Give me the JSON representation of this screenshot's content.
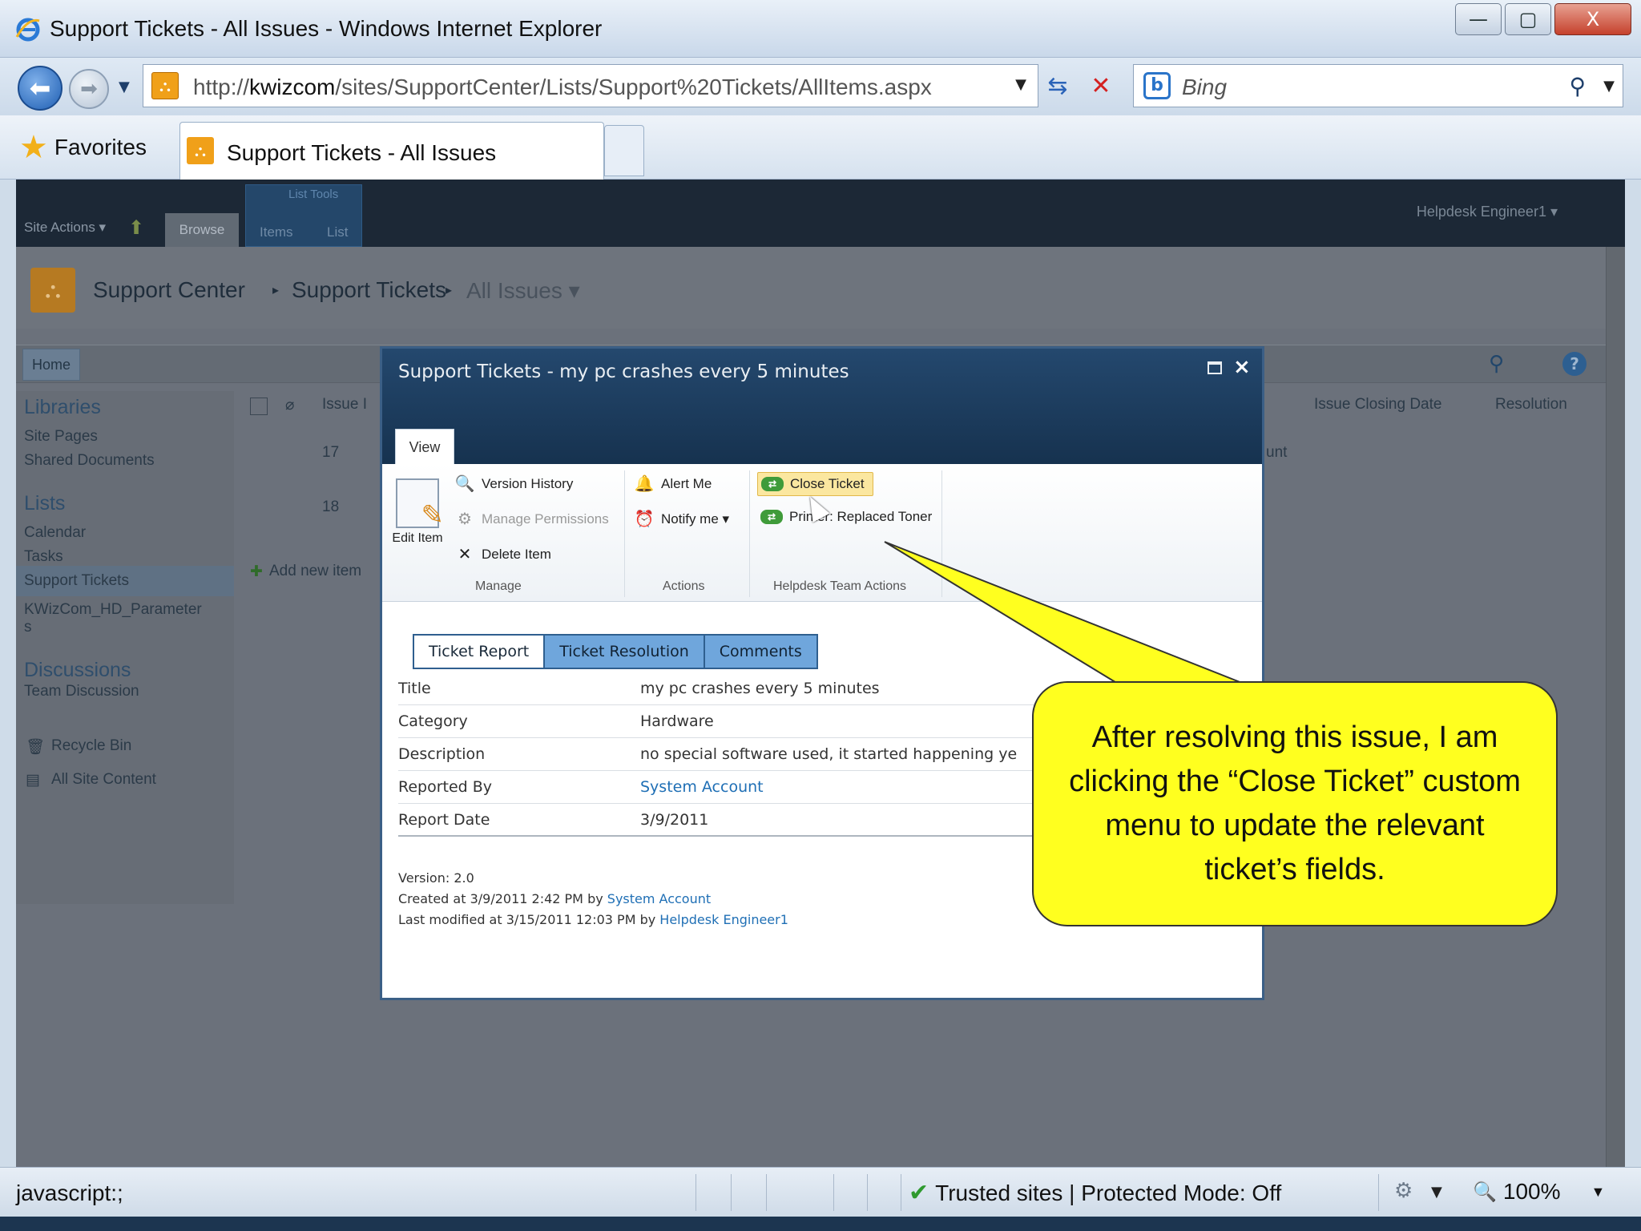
{
  "window": {
    "title": "Support Tickets - All Issues - Windows Internet Explorer",
    "controls": {
      "minimize": "—",
      "maximize": "▢",
      "close": "X"
    }
  },
  "address": {
    "url_prefix": "http://",
    "url_host": "kwizcom",
    "url_path": "/sites/SupportCenter/Lists/Support%20Tickets/AllItems.aspx"
  },
  "search": {
    "placeholder": "Bing"
  },
  "favorites": {
    "label": "Favorites"
  },
  "tab": {
    "label": "Support Tickets - All Issues"
  },
  "sp": {
    "site_actions": "Site Actions ▾",
    "browse": "Browse",
    "list_tools": "List Tools",
    "items": "Items",
    "list": "List",
    "user": "Helpdesk Engineer1 ▾",
    "breadcrumb": [
      "Support Center",
      "Support Tickets",
      "All Issues ▾"
    ],
    "home": "Home",
    "quicklaunch": {
      "libraries": "Libraries",
      "site_pages": "Site Pages",
      "shared_documents": "Shared Documents",
      "lists": "Lists",
      "calendar": "Calendar",
      "tasks": "Tasks",
      "support_tickets": "Support Tickets",
      "kwizcom_param": "KWizCom_HD_Parameter",
      "kwizcom_param_s": "s",
      "discussions": "Discussions",
      "team_discussion": "Team Discussion",
      "recycle_bin": "Recycle Bin",
      "all_site_content": "All Site Content"
    },
    "list_headers": {
      "issue": "Issue I",
      "closing_date": "Issue Closing Date",
      "resolution": "Resolution"
    },
    "rows": [
      "17",
      "18"
    ],
    "row_tail": "unt",
    "add_new_item": "Add new item"
  },
  "dialog": {
    "title": "Support Tickets - my pc crashes every 5 minutes",
    "view_tab": "View",
    "ribbon": {
      "edit_item": "Edit Item",
      "version_history": "Version History",
      "manage_permissions": "Manage Permissions",
      "delete_item": "Delete Item",
      "manage_group": "Manage",
      "alert_me": "Alert Me",
      "notify_me": "Notify me ▾",
      "actions_group": "Actions",
      "close_ticket": "Close Ticket",
      "printer_replaced": "Printer: Replaced Toner",
      "helpdesk_group": "Helpdesk Team Actions"
    },
    "form_tabs": [
      "Ticket Report",
      "Ticket Resolution",
      "Comments"
    ],
    "fields": [
      {
        "label": "Title",
        "value": "my pc crashes every 5 minutes"
      },
      {
        "label": "Category",
        "value": "Hardware"
      },
      {
        "label": "Description",
        "value": "no special software used, it started happening ye"
      },
      {
        "label": "Reported By",
        "value": "System Account"
      },
      {
        "label": "Report Date",
        "value": "3/9/2011"
      }
    ],
    "version": "Version: 2.0",
    "created_prefix": "Created at 3/9/2011 2:42 PM by ",
    "created_by": "System Account",
    "modified_prefix": "Last modified at 3/15/2011 12:03 PM by ",
    "modified_by": "Helpdesk Engineer1"
  },
  "callout": {
    "text": "After resolving this issue, I am clicking the  “Close Ticket” custom menu to update the relevant ticket’s fields."
  },
  "status": {
    "text": "javascript:;",
    "zone": "Trusted sites | Protected Mode: Off",
    "zoom": "100%"
  }
}
